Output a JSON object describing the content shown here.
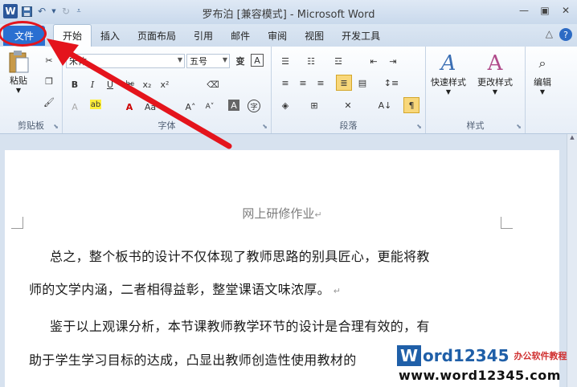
{
  "titlebar": {
    "logo": "W",
    "title": "罗布泊 [兼容模式] - Microsoft Word",
    "icons": [
      "save-icon",
      "undo-icon",
      "redo-icon",
      "customize-icon"
    ],
    "controls": [
      "minimize-icon",
      "restore-icon",
      "close-icon"
    ]
  },
  "tabs": {
    "file": "文件",
    "items": [
      "开始",
      "插入",
      "页面布局",
      "引用",
      "邮件",
      "审阅",
      "视图",
      "开发工具"
    ],
    "active": "开始"
  },
  "ribbon": {
    "clipboard": {
      "label": "剪贴板",
      "paste": "粘贴"
    },
    "font": {
      "label": "字体",
      "font_name": "宋体",
      "font_size": "五号"
    },
    "paragraph": {
      "label": "段落"
    },
    "styles": {
      "label": "样式",
      "quick_styles": "快速样式",
      "change_styles": "更改样式"
    },
    "editing": {
      "label": "编辑"
    }
  },
  "document": {
    "title": "网上研修作业",
    "paragraphs": [
      "总之，整个板书的设计不仅体现了教师思路的别具匠心，更能将教",
      "师的文学内涵，二者相得益彰，整堂课语文味浓厚。",
      "鉴于以上观课分析，本节课教师教学环节的设计是合理有效的，有",
      "助于学生学习目标的达成，凸显出教师创造性使用教材的"
    ]
  },
  "watermark": {
    "logo": "W",
    "brand": "ord12345",
    "brand_cn": "办公软件教程",
    "url": "www.word12345.com"
  },
  "colors": {
    "file_tab": "#2a6fd1",
    "annotation": "#e4141c"
  }
}
